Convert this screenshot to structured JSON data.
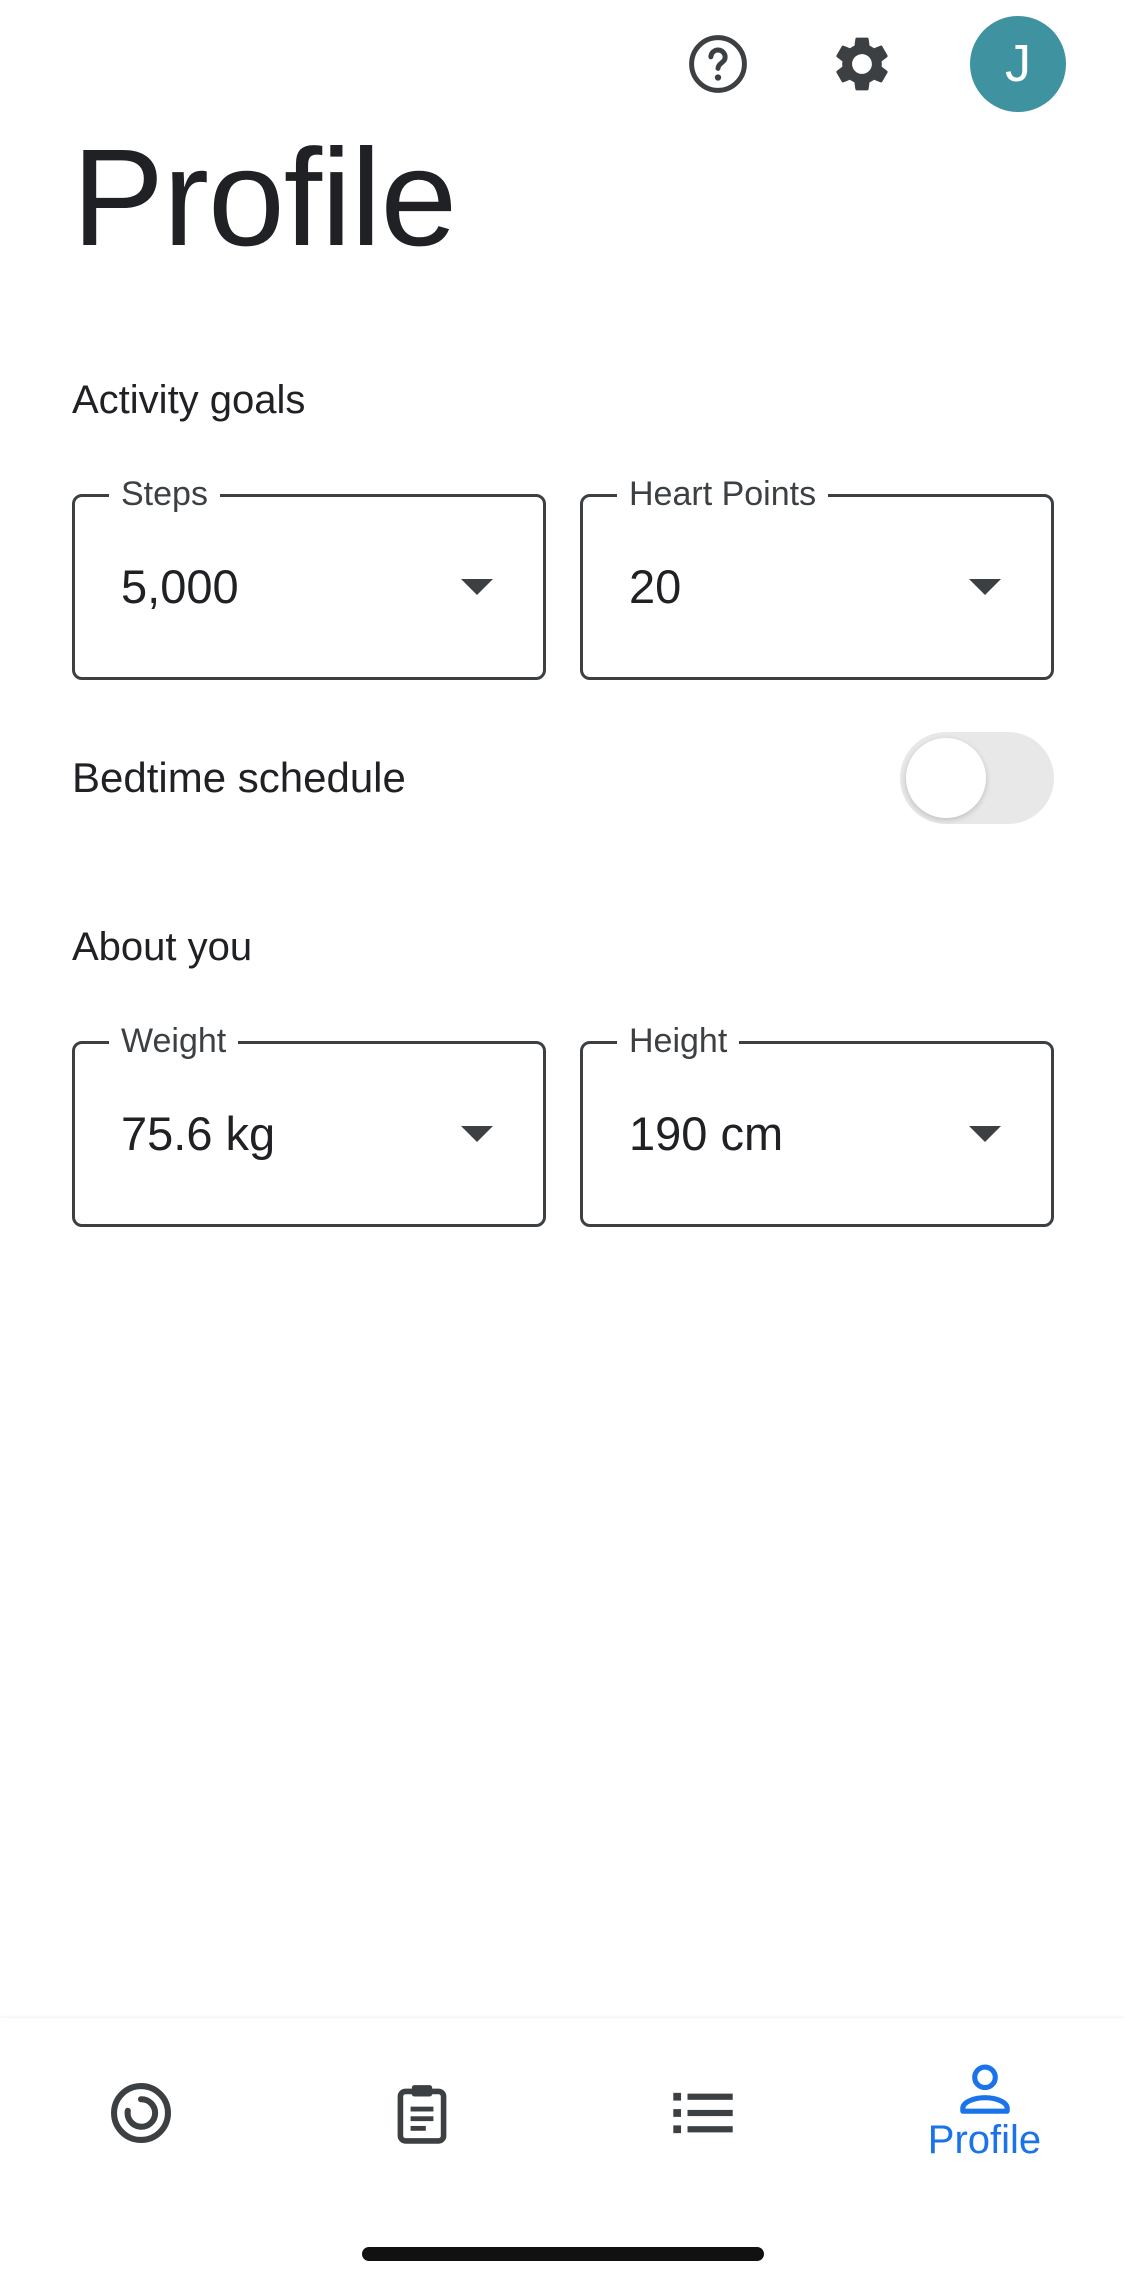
{
  "header": {
    "help_icon": "help-circle-icon",
    "settings_icon": "gear-icon",
    "avatar_initial": "J",
    "avatar_color": "#3f929f"
  },
  "page": {
    "title": "Profile"
  },
  "activity_goals": {
    "title": "Activity goals",
    "steps": {
      "label": "Steps",
      "value": "5,000"
    },
    "heart_points": {
      "label": "Heart Points",
      "value": "20"
    }
  },
  "bedtime": {
    "label": "Bedtime schedule",
    "enabled": false
  },
  "about_you": {
    "title": "About you",
    "weight": {
      "label": "Weight",
      "value": "75.6 kg"
    },
    "height": {
      "label": "Height",
      "value": "190 cm"
    }
  },
  "bottom_nav": {
    "items": [
      {
        "icon": "home-ring-icon",
        "label": ""
      },
      {
        "icon": "journal-clipboard-icon",
        "label": ""
      },
      {
        "icon": "browse-list-icon",
        "label": ""
      },
      {
        "icon": "profile-person-icon",
        "label": "Profile",
        "active": true
      }
    ],
    "active_color": "#1a73e8"
  }
}
